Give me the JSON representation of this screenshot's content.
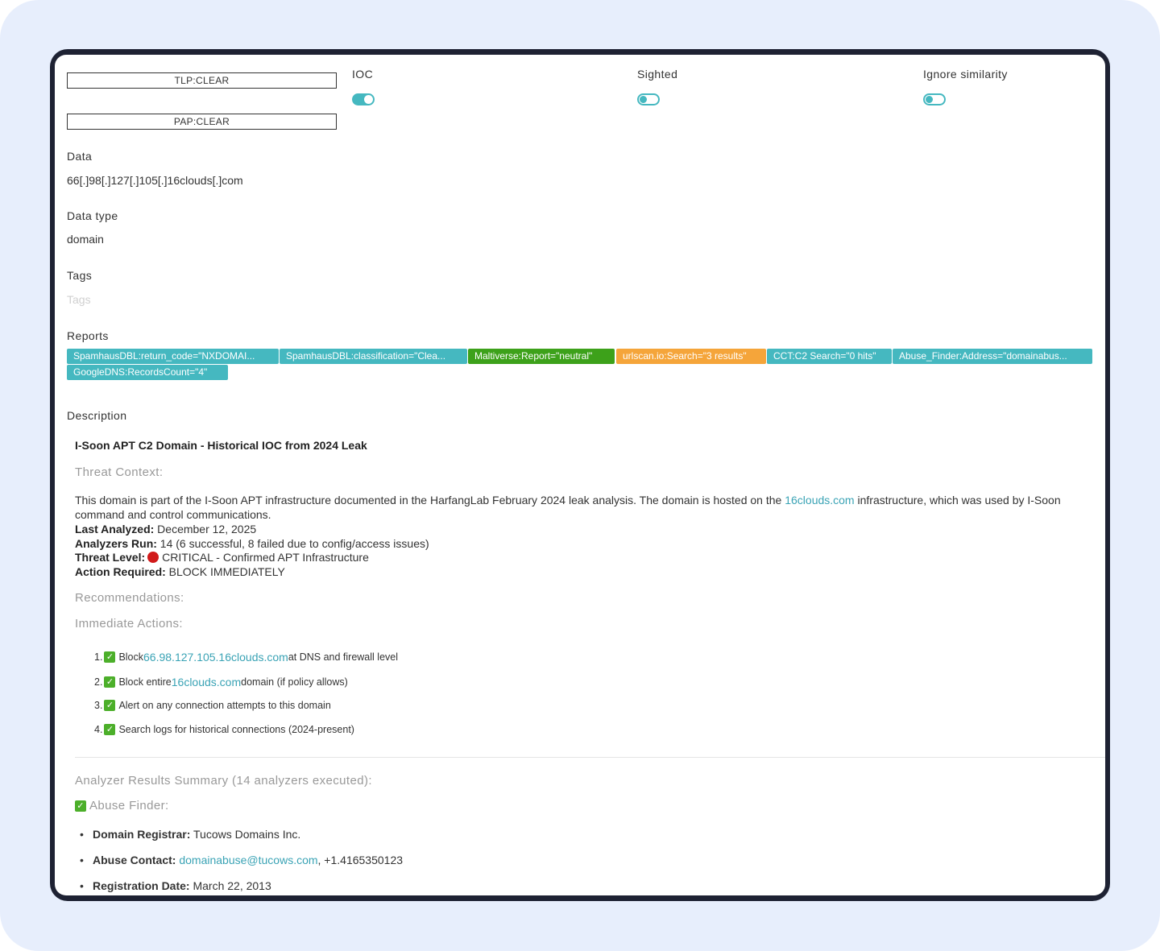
{
  "header": {
    "tlp_label": "TLP:CLEAR",
    "pap_label": "PAP:CLEAR",
    "toggles": [
      {
        "label": "IOC",
        "state": "on"
      },
      {
        "label": "Sighted",
        "state": "off"
      },
      {
        "label": "Ignore similarity",
        "state": "off"
      }
    ]
  },
  "fields": {
    "data_label": "Data",
    "data_value": "66[.]98[.]127[.]105[.]16clouds[.]com",
    "datatype_label": "Data type",
    "datatype_value": "domain",
    "tags_label": "Tags",
    "tags_placeholder": "Tags",
    "reports_label": "Reports",
    "description_label": "Description"
  },
  "reports": [
    {
      "text": "SpamhausDBL:return_code=\"NXDOMAI...",
      "color": "#45b8c0"
    },
    {
      "text": "SpamhausDBL:classification=\"Clea...",
      "color": "#45b8c0"
    },
    {
      "text": "Maltiverse:Report=\"neutral\"",
      "color": "#3da11a"
    },
    {
      "text": "urlscan.io:Search=\"3 results\"",
      "color": "#f5a53a"
    },
    {
      "text": "CCT:C2 Search=\"0 hits\"",
      "color": "#45b8c0"
    },
    {
      "text": "Abuse_Finder:Address=\"domainabus...",
      "color": "#45b8c0"
    },
    {
      "text": "GoogleDNS:RecordsCount=\"4\"",
      "color": "#45b8c0"
    }
  ],
  "description": {
    "title": "I-Soon APT C2 Domain - Historical IOC from 2024 Leak",
    "threat_context_heading": "Threat Context:",
    "context_line1_a": "This domain is part of the I-Soon APT infrastructure documented in the HarfangLab February 2024 leak analysis. The domain is hosted on the ",
    "context_link": "16clouds.com",
    "context_line1_b": " infrastructure, which was used by I-Soon",
    "context_line2": "command and control communications.",
    "last_analyzed_label": "Last Analyzed:",
    "last_analyzed_value": " December 12, 2025",
    "analyzers_run_label": "Analyzers Run:",
    "analyzers_run_value": " 14 (6 successful, 8 failed due to config/access issues)",
    "threat_level_label": "Threat Level:",
    "threat_level_value": "CRITICAL - Confirmed APT Infrastructure",
    "action_required_label": "Action Required:",
    "action_required_value": " BLOCK IMMEDIATELY",
    "recommendations_heading": "Recommendations:",
    "immediate_actions_heading": "Immediate Actions:",
    "actions": [
      {
        "num": "1.",
        "pre": "Block ",
        "link": "66.98.127.105.16clouds.com",
        "post": " at DNS and firewall level"
      },
      {
        "num": "2.",
        "pre": "Block entire ",
        "link": "16clouds.com",
        "post": " domain (if policy allows)"
      },
      {
        "num": "3.",
        "pre": "Alert on any connection attempts to this domain",
        "link": "",
        "post": ""
      },
      {
        "num": "4.",
        "pre": "Search logs for historical connections (2024-present)",
        "link": "",
        "post": ""
      }
    ],
    "analyzer_summary_heading": "Analyzer Results Summary (14 analyzers executed):",
    "abuse_finder_heading": "Abuse Finder:",
    "abuse_items": [
      {
        "label": "Domain Registrar:",
        "pre": " Tucows Domains Inc.",
        "link": "",
        "post": ""
      },
      {
        "label": "Abuse Contact:",
        "pre": " ",
        "link": "domainabuse@tucows.com",
        "post": ", +1.4165350123"
      },
      {
        "label": "Registration Date:",
        "pre": " March 22, 2013",
        "link": "",
        "post": ""
      }
    ]
  }
}
